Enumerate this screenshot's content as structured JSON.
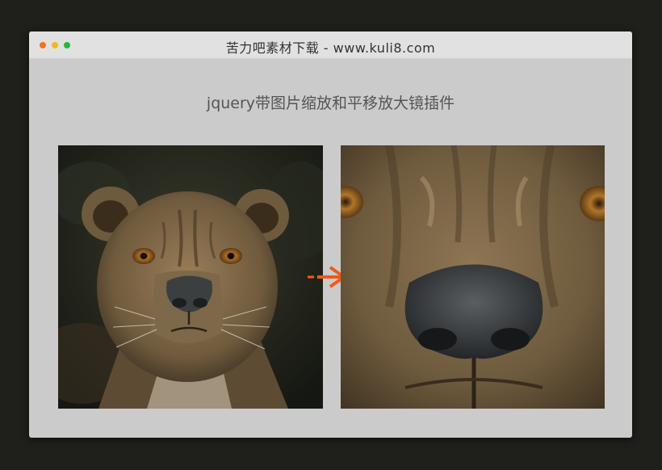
{
  "window": {
    "title": "苦力吧素材下载 - www.kuli8.com",
    "controls": [
      "close-dot",
      "minimize-dot",
      "maximize-dot"
    ]
  },
  "page": {
    "heading": "jquery带图片缩放和平移放大镜插件"
  },
  "images": {
    "source": {
      "subject": "lioness-portrait"
    },
    "zoom": {
      "subject": "lioness-face-magnified"
    }
  },
  "icons": {
    "arrow": "arrow-right-icon"
  },
  "colors": {
    "accent": "#f15a19",
    "window_bg": "#cbcbcb",
    "titlebar_bg": "#e1e1e1",
    "page_bg": "#1f201b"
  }
}
